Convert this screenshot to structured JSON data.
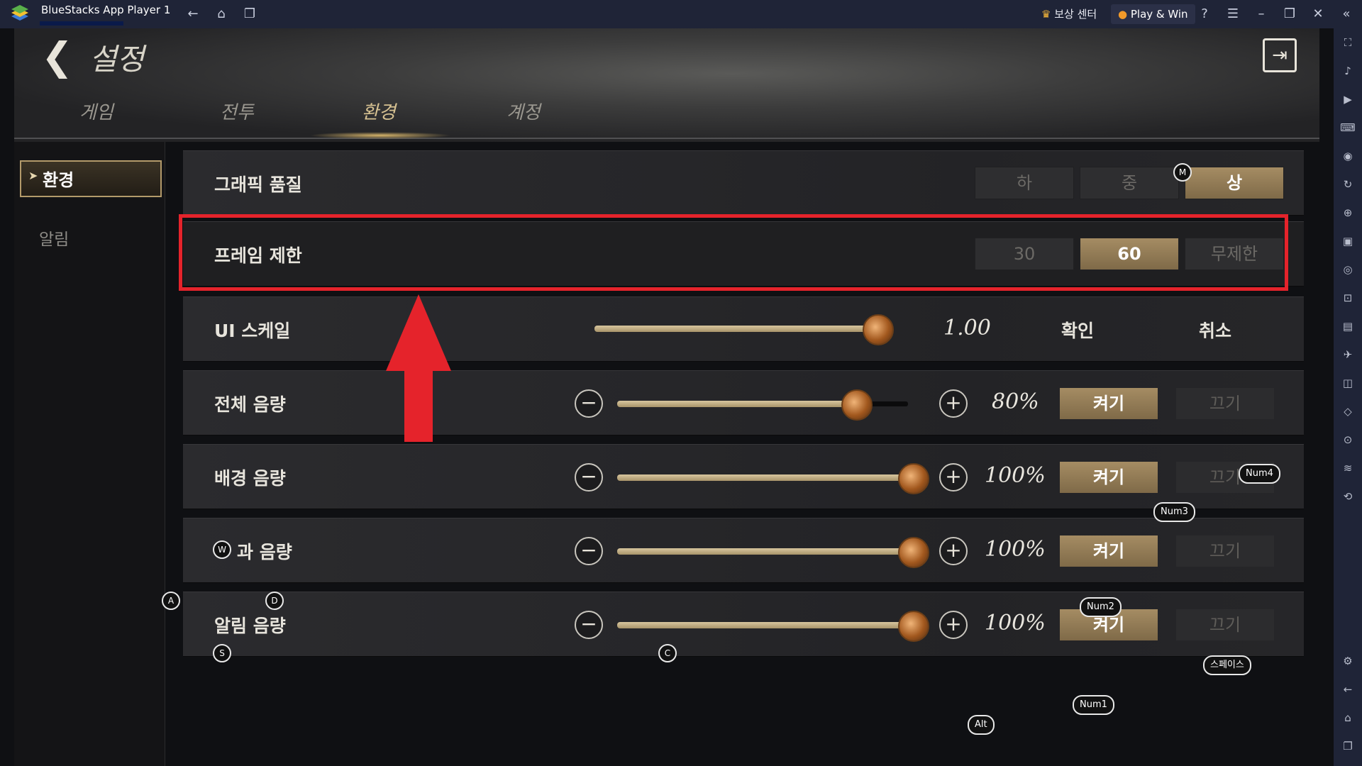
{
  "window": {
    "title": "BlueStacks App Player 1",
    "reward_center": "보상 센터",
    "play_win": "Play & Win"
  },
  "game": {
    "page_title": "설정",
    "tabs": [
      "게임",
      "전투",
      "환경",
      "계정"
    ],
    "active_tab": "환경",
    "side_items": [
      "환경",
      "알림"
    ],
    "settings": {
      "graphics": {
        "label": "그래픽 품질",
        "options": [
          "하",
          "중",
          "상"
        ],
        "selected": "상"
      },
      "frame": {
        "label": "프레임 제한",
        "options": [
          "30",
          "60",
          "무제한"
        ],
        "selected": "60"
      },
      "ui_scale": {
        "label": "UI 스케일",
        "value": "1.00",
        "confirm": "확인",
        "cancel": "취소",
        "level": 1.0
      },
      "master_volume": {
        "label": "전체 음량",
        "value": "80%",
        "level": 0.8,
        "on": "켜기",
        "off": "끄기"
      },
      "bg_volume": {
        "label": "배경 음량",
        "value": "100%",
        "level": 1.0,
        "on": "켜기",
        "off": "끄기"
      },
      "sfx_volume": {
        "label": "과 음량",
        "value": "100%",
        "level": 1.0,
        "on": "켜기",
        "off": "끄기"
      },
      "alert_volume": {
        "label": "알림 음량",
        "value": "100%",
        "level": 1.0,
        "on": "켜기",
        "off": "끄기"
      }
    }
  },
  "keymap": {
    "m": "M",
    "w": "W",
    "a": "A",
    "d": "D",
    "s": "S",
    "c": "C",
    "num1": "Num1",
    "num2": "Num2",
    "num3": "Num3",
    "num4": "Num4",
    "alt": "Alt",
    "space": "스페이스"
  },
  "colors": {
    "highlight": "#e5232b",
    "accent": "#a58c63",
    "chrome": "#1f2437"
  }
}
